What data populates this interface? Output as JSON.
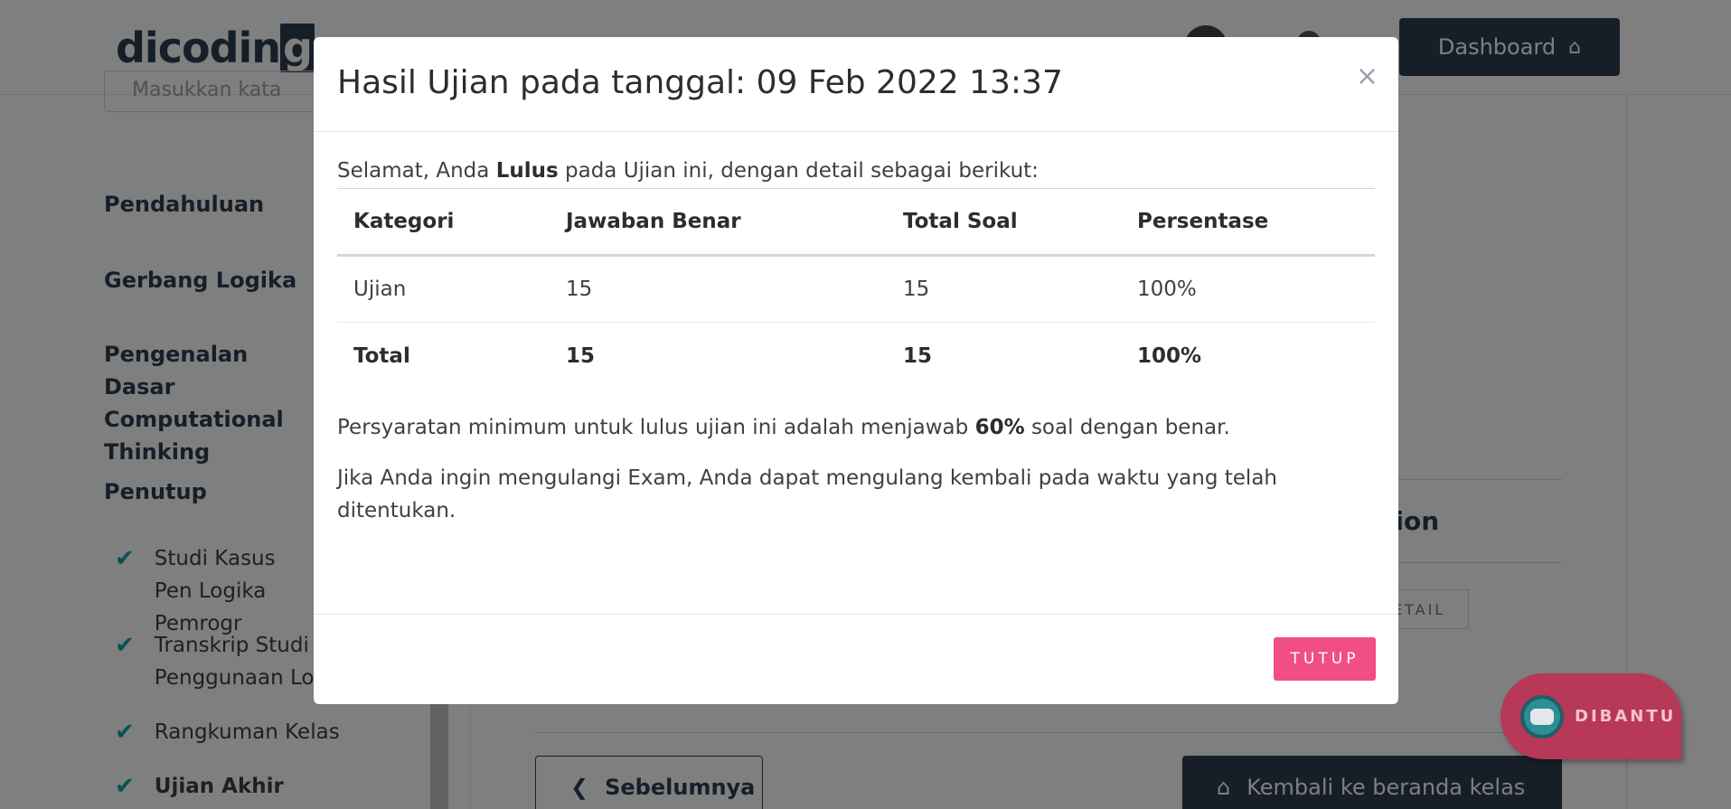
{
  "header": {
    "logo_text": "dicodin",
    "logo_tail": "g",
    "dashboard_label": "Dashboard",
    "dashboard_icon": "home-icon"
  },
  "sidebar": {
    "search_placeholder": "Masukkan kata",
    "sections": [
      {
        "label": "Pendahuluan"
      },
      {
        "label": "Gerbang Logika"
      },
      {
        "label": "Pengenalan Dasar Computational Thinking"
      },
      {
        "label": "Penutup"
      }
    ],
    "items": [
      {
        "label": "Studi Kasus Pen Logika Pemrogr"
      },
      {
        "label": "Transkrip Studi Penggunaan Lo"
      },
      {
        "label": "Rangkuman Kelas"
      },
      {
        "label": "Ujian Akhir"
      }
    ]
  },
  "main": {
    "section_title_partial": "tion",
    "detail_partial": "ETAIL",
    "prev_label": "Sebelumnya",
    "home_label": "Kembali ke beranda kelas"
  },
  "modal": {
    "title": "Hasil Ujian pada tanggal: 09 Feb 2022 13:37",
    "close_glyph": "×",
    "intro_before": "Selamat, Anda ",
    "intro_status": "Lulus",
    "intro_after": " pada Ujian ini, dengan detail sebagai berikut:",
    "table": {
      "headers": [
        "Kategori",
        "Jawaban Benar",
        "Total Soal",
        "Persentase"
      ],
      "rows": [
        [
          "Ujian",
          "15",
          "15",
          "100%"
        ]
      ],
      "total": [
        "Total",
        "15",
        "15",
        "100%"
      ]
    },
    "requirement_before": "Persyaratan minimum untuk lulus ujian ini adalah menjawab ",
    "requirement_value": "60%",
    "requirement_after": " soal dengan benar.",
    "retake_text": "Jika Anda ingin mengulangi Exam, Anda dapat mengulang kembali pada waktu yang telah ditentukan.",
    "close_button": "TUTUP"
  },
  "chat": {
    "label": "DIBANTU",
    "icon": "robot-icon"
  },
  "colors": {
    "brand_dark": "#2d3e50",
    "accent_pink": "#f04e85",
    "check_teal": "#11a5a5",
    "chat_bg": "#b83857"
  }
}
